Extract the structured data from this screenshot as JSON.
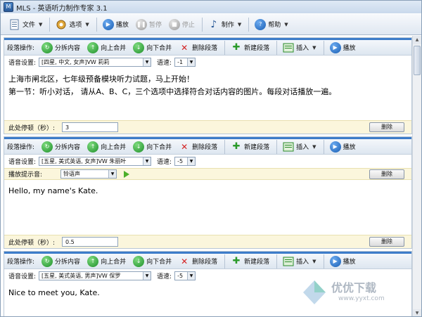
{
  "window": {
    "title": "MLS - 英语听力制作专家 3.1"
  },
  "toolbar": {
    "items": [
      {
        "label": "文件",
        "icon": "document-icon",
        "dropdown": true
      },
      {
        "label": "选项",
        "icon": "gear-icon",
        "dropdown": true
      },
      {
        "label": "播放",
        "icon": "play-icon",
        "enabled": true
      },
      {
        "label": "暂停",
        "icon": "pause-icon",
        "enabled": false
      },
      {
        "label": "停止",
        "icon": "stop-icon",
        "enabled": false
      },
      {
        "label": "制作",
        "icon": "music-note-icon",
        "dropdown": true
      },
      {
        "label": "帮助",
        "icon": "help-icon",
        "dropdown": true
      }
    ]
  },
  "section_labels": {
    "ops": "段落操作:",
    "voice": "语音设置:",
    "speed": "语速:",
    "pause": "此处停顿（秒）:",
    "cue": "播放提示音:",
    "delete": "删除"
  },
  "section_actions": {
    "analyze": "分拆内容",
    "merge_up": "向上合并",
    "merge_down": "向下合并",
    "delete_para": "删除段落",
    "new_para": "新建段落",
    "insert": "插入",
    "play": "播放"
  },
  "sections": [
    {
      "voice": "[四星, 中文, 女声]VW 莉莉",
      "speed": "-1",
      "text_lines": [
        "上海市闸北区，七年级预备模块听力试题，马上开始！",
        "第一节：听小对话， 请从A、B、C，三个选项中选择符合对话内容的图片。每段对话播放一遍。"
      ],
      "pause": "3"
    },
    {
      "voice": "[五星, 美式英语, 女声]VW 朱丽叶",
      "speed": "-5",
      "cue": "铃语声",
      "text_lines": [
        "Hello, my name's Kate."
      ],
      "pause": "0.5"
    },
    {
      "voice": "[五星, 美式英语, 男声]VW 保罗",
      "speed": "-5",
      "text_lines": [
        "Nice to meet you, Kate."
      ]
    }
  ],
  "watermark": {
    "text": "优优下载",
    "url": "www.yyxt.com"
  }
}
